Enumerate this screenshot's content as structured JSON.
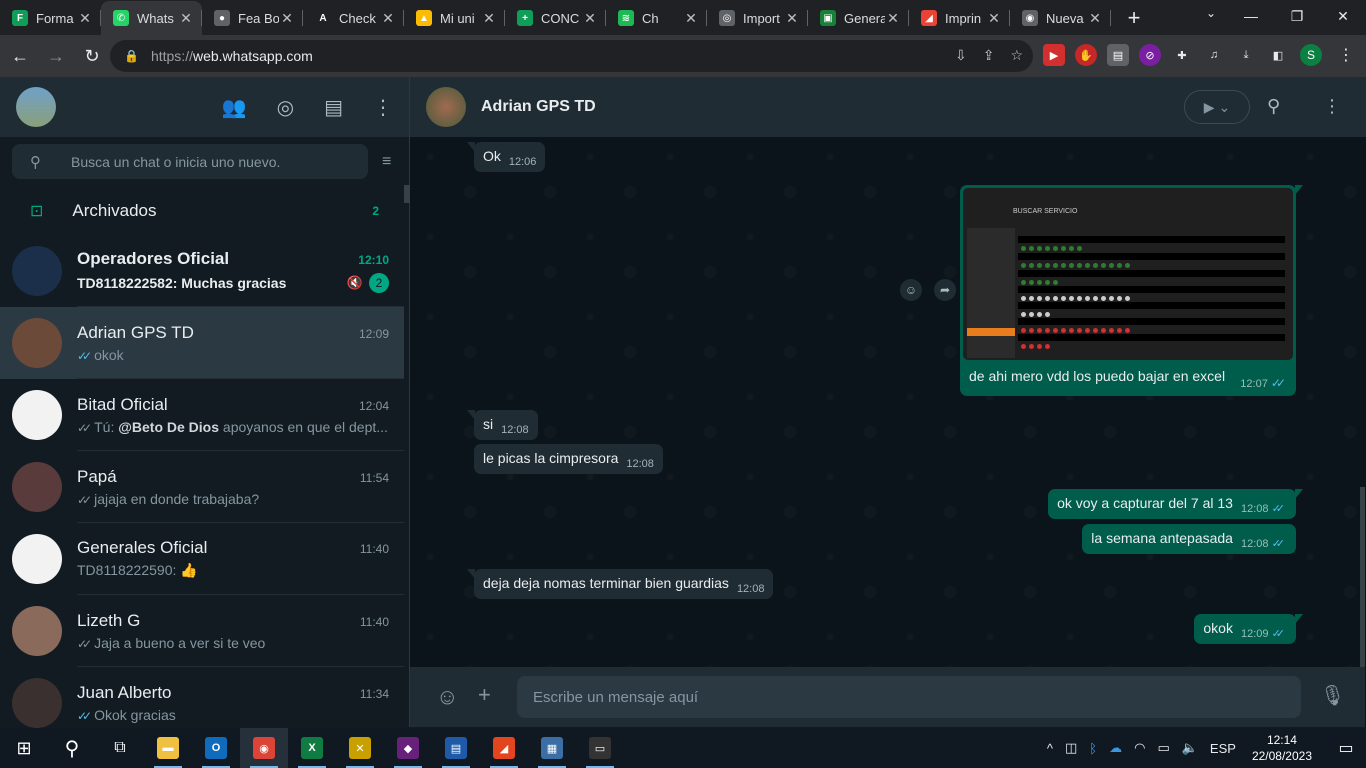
{
  "browser": {
    "tabs": [
      {
        "title": "Forma",
        "fav_color": "#0f9d58",
        "fav_glyph": "F"
      },
      {
        "title": "Whats",
        "fav_color": "#25d366",
        "fav_glyph": "✆",
        "active": true
      },
      {
        "title": "Fea Bo",
        "fav_color": "#5f6368",
        "fav_glyph": "●"
      },
      {
        "title": "Check",
        "fav_color": "#202124",
        "fav_glyph": "A"
      },
      {
        "title": "Mi uni",
        "fav_color": "#fbbc04",
        "fav_glyph": "▲"
      },
      {
        "title": "CONC",
        "fav_color": "#0f9d58",
        "fav_glyph": "+"
      },
      {
        "title": "Ch",
        "fav_color": "#1db954",
        "fav_glyph": "≋"
      },
      {
        "title": "Import",
        "fav_color": "#5f6368",
        "fav_glyph": "◎"
      },
      {
        "title": "Genera",
        "fav_color": "#188038",
        "fav_glyph": "▣"
      },
      {
        "title": "Imprin",
        "fav_color": "#ea4335",
        "fav_glyph": "◢"
      },
      {
        "title": "Nueva",
        "fav_color": "#5f6368",
        "fav_glyph": "◉"
      }
    ],
    "url_scheme": "https://",
    "url_host": "web.whatsapp.com",
    "profile_initial": "S"
  },
  "sidebar": {
    "search_placeholder": "Busca un chat o inicia uno nuevo.",
    "archived_label": "Archivados",
    "archived_count": "2",
    "chats": [
      {
        "name": "Operadores Oficial",
        "time": "12:10",
        "preview": "TD8118222582: Muchas gracias",
        "unread": "2",
        "bold": true,
        "muted": true,
        "avatar_color": "#1c2f4a"
      },
      {
        "name": "Adrian GPS TD",
        "time": "12:09",
        "preview": "okok",
        "ticks": "blue",
        "selected": true,
        "avatar_color": "#6b4a3a"
      },
      {
        "name": "Bitad Oficial",
        "time": "12:04",
        "preview_prefix": "Tú: ",
        "mention": "@Beto De Dios",
        "preview": " apoyanos en que el dept...",
        "ticks": "grey",
        "avatar_color": "#f2f2f2"
      },
      {
        "name": "Papá",
        "time": "11:54",
        "preview": "jajaja en donde trabajaba?",
        "ticks": "grey",
        "avatar_color": "#5a3b3b"
      },
      {
        "name": "Generales Oficial",
        "time": "11:40",
        "preview": "TD8118222590: 👍",
        "avatar_color": "#f2f2f2"
      },
      {
        "name": "Lizeth G",
        "time": "11:40",
        "preview": "Jaja a bueno a ver si te veo",
        "ticks": "grey",
        "avatar_color": "#8a6a5a"
      },
      {
        "name": "Juan Alberto",
        "time": "11:34",
        "preview": "Okok gracias",
        "ticks": "blue",
        "avatar_color": "#3a3030"
      }
    ]
  },
  "conversation": {
    "contact_name": "Adrian GPS TD",
    "image_header_text": "BUSCAR SERVICIO",
    "messages": [
      {
        "id": "m1",
        "dir": "in",
        "text": "Ok",
        "time": "12:06"
      },
      {
        "id": "m2",
        "dir": "out",
        "text": "de ahi mero vdd los puedo bajar en excel",
        "time": "12:07",
        "image": true
      },
      {
        "id": "m3",
        "dir": "in",
        "text": "si",
        "time": "12:08"
      },
      {
        "id": "m4",
        "dir": "in",
        "text": "le picas la cimpresora",
        "time": "12:08"
      },
      {
        "id": "m5",
        "dir": "out",
        "text": "ok voy a capturar del 7 al 13",
        "time": "12:08"
      },
      {
        "id": "m6",
        "dir": "out",
        "text": "la semana antepasada",
        "time": "12:08"
      },
      {
        "id": "m7",
        "dir": "in",
        "text": "deja deja nomas terminar bien guardias",
        "time": "12:08"
      },
      {
        "id": "m8",
        "dir": "out",
        "text": "okok",
        "time": "12:09"
      }
    ],
    "composer_placeholder": "Escribe un mensaje aquí"
  },
  "taskbar": {
    "lang": "ESP",
    "time": "12:14",
    "date": "22/08/2023",
    "apps": [
      {
        "name": "file-explorer",
        "color": "#f0c040",
        "glyph": "▬"
      },
      {
        "name": "outlook",
        "color": "#0f6cbd",
        "glyph": "O"
      },
      {
        "name": "chrome",
        "color": "#db4437",
        "glyph": "◉",
        "active": true
      },
      {
        "name": "excel",
        "color": "#107c41",
        "glyph": "X"
      },
      {
        "name": "tool",
        "color": "#c8a000",
        "glyph": "✕"
      },
      {
        "name": "visual-studio",
        "color": "#68217a",
        "glyph": "◆"
      },
      {
        "name": "app-window",
        "color": "#1e5aa8",
        "glyph": "▤"
      },
      {
        "name": "pdf",
        "color": "#e3461f",
        "glyph": "◢"
      },
      {
        "name": "calculator",
        "color": "#3a6ea5",
        "glyph": "▦"
      },
      {
        "name": "bitad",
        "color": "#333333",
        "glyph": "▭"
      }
    ]
  }
}
